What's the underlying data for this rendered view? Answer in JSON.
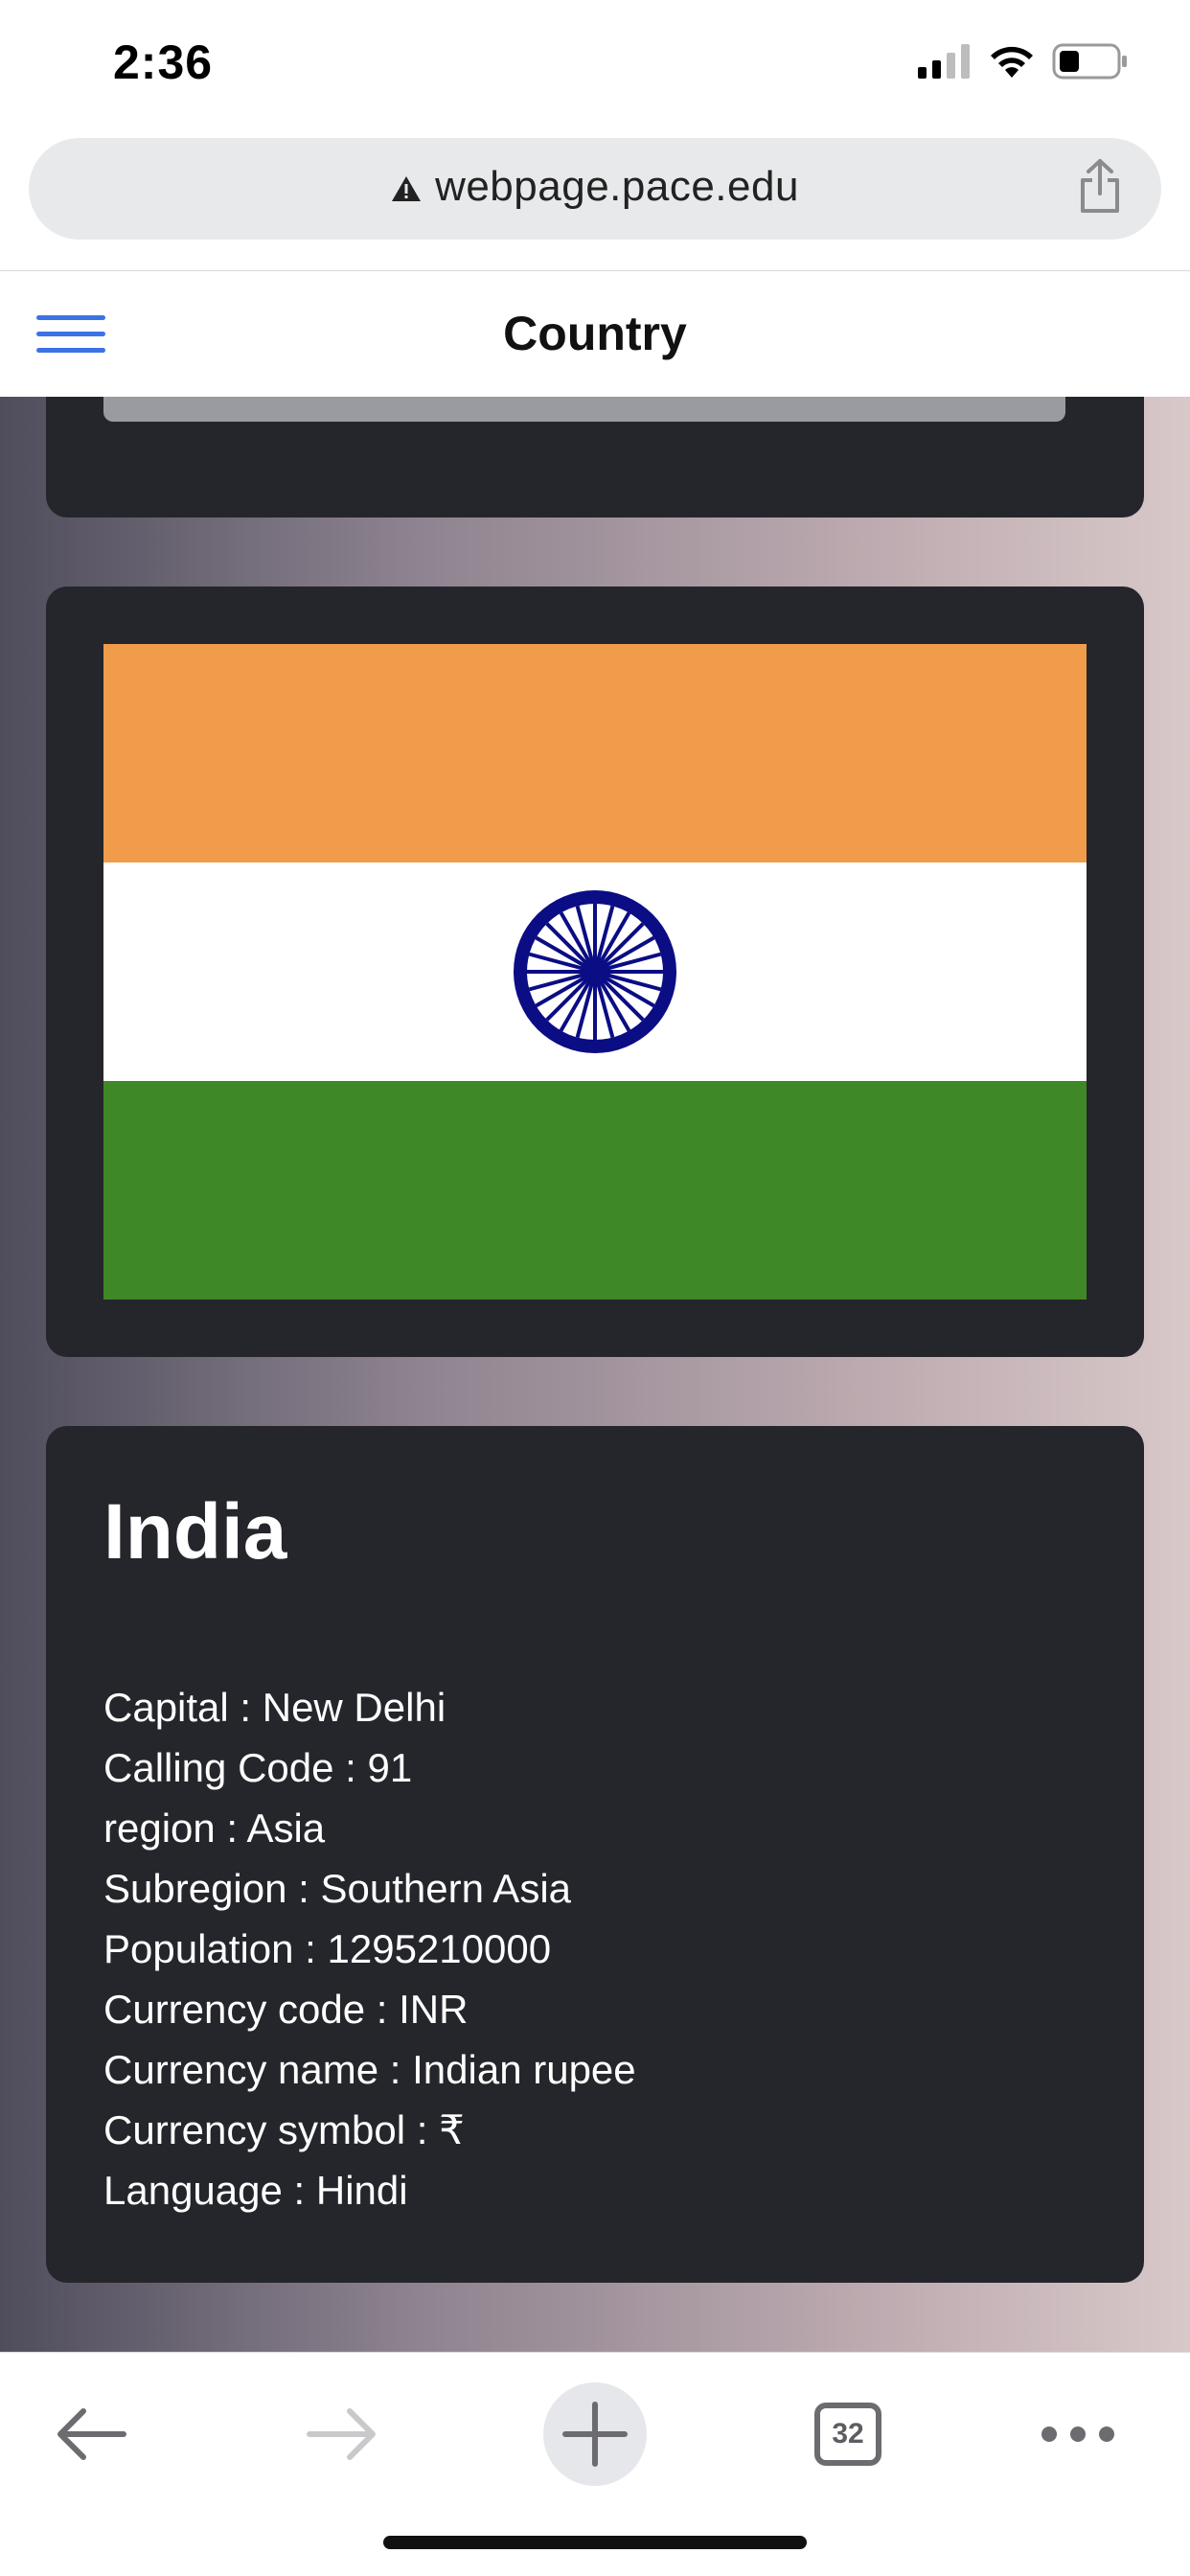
{
  "status_bar": {
    "time": "2:36"
  },
  "browser": {
    "url": "webpage.pace.edu",
    "tab_count": "32"
  },
  "navbar": {
    "title": "Country"
  },
  "country": {
    "name": "India",
    "flag_colors": {
      "saffron": "#f09c4a",
      "white": "#ffffff",
      "green": "#3f8828",
      "chakra": "#0b0d84"
    },
    "details": [
      "Capital : New Delhi",
      "Calling Code : 91",
      "region : Asia",
      "Subregion : Southern Asia",
      "Population : 1295210000",
      "Currency code : INR",
      "Currency name : Indian rupee",
      "Currency symbol : ₹",
      "Language : Hindi"
    ]
  },
  "colors": {
    "card_bg": "#25262b",
    "accent": "#3b73e6"
  }
}
